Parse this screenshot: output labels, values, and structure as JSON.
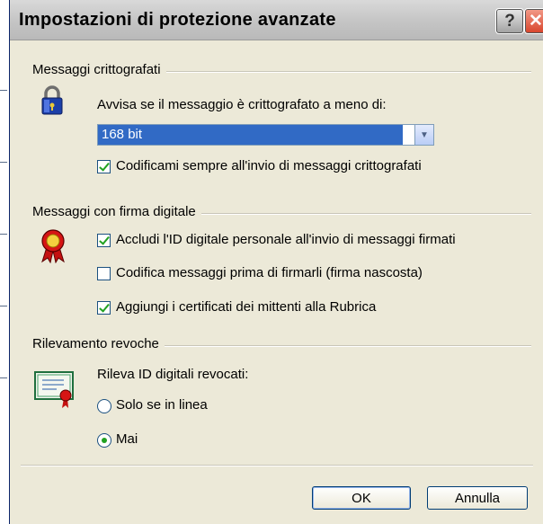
{
  "window": {
    "title": "Impostazioni di protezione avanzate",
    "help_label": "?",
    "close_label": "✕"
  },
  "encrypted": {
    "section_title": "Messaggi crittografati",
    "warn_label": "Avvisa se il messaggio è crittografato a meno di:",
    "select_value": "168 bit",
    "always_encrypt_label": "Codificami sempre all'invio di messaggi crittografati",
    "always_encrypt_checked": true,
    "icon": "padlock-icon"
  },
  "signed": {
    "section_title": "Messaggi con firma digitale",
    "include_id_label": "Accludi l'ID digitale personale all'invio di messaggi firmati",
    "include_id_checked": true,
    "encode_before_sign_label": "Codifica messaggi prima di firmarli (firma nascosta)",
    "encode_before_sign_checked": false,
    "add_certs_label": "Aggiungi i certificati dei mittenti alla Rubrica",
    "add_certs_checked": true,
    "icon": "ribbon-award-icon"
  },
  "revocation": {
    "section_title": "Rilevamento revoche",
    "check_label": "Rileva ID digitali revocati:",
    "online_only_label": "Solo se in linea",
    "online_only_selected": false,
    "never_label": "Mai",
    "never_selected": true,
    "icon": "certificate-icon"
  },
  "buttons": {
    "ok_label": "OK",
    "cancel_label": "Annulla"
  },
  "colors": {
    "dialog_bg": "#ece9d8",
    "selection": "#316ac5",
    "check_green": "#21a121"
  }
}
